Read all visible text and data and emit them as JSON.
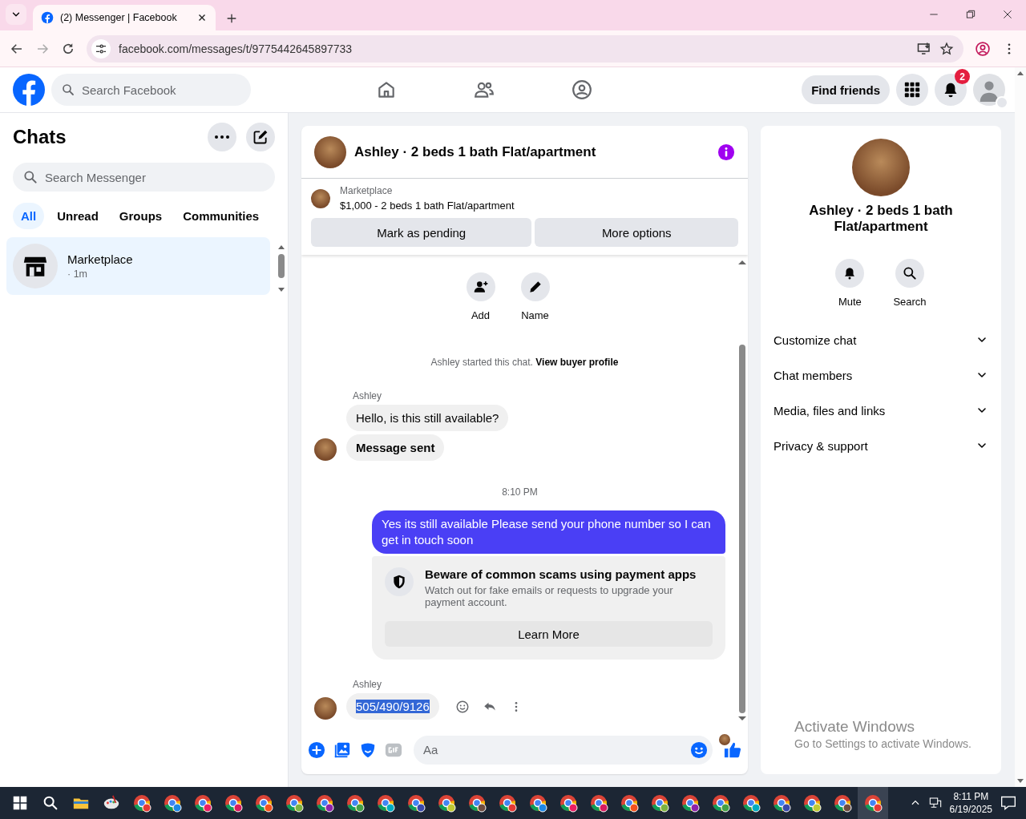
{
  "browser": {
    "tab_title": "(2) Messenger | Facebook",
    "url": "facebook.com/messages/t/9775442645897733"
  },
  "header": {
    "search_placeholder": "Search Facebook",
    "find_friends": "Find friends",
    "notification_count": "2"
  },
  "chats": {
    "title": "Chats",
    "search_placeholder": "Search Messenger",
    "filters": [
      {
        "label": "All",
        "selected": true
      },
      {
        "label": "Unread",
        "selected": false
      },
      {
        "label": "Groups",
        "selected": false
      },
      {
        "label": "Communities",
        "selected": false
      }
    ],
    "conversations": [
      {
        "name": "Marketplace",
        "meta": "· 1m",
        "selected": true
      }
    ]
  },
  "conversation": {
    "title": "Ashley · 2 beds 1 bath Flat/apartment",
    "listing": {
      "source": "Marketplace",
      "title": "$1,000 - 2 beds 1 bath Flat/apartment"
    },
    "actions": [
      "Mark as pending",
      "More options"
    ],
    "quick_actions": [
      {
        "label": "Add",
        "kind": "add"
      },
      {
        "label": "Name",
        "kind": "name"
      }
    ],
    "notice": {
      "text": "Ashley started this chat.",
      "link": "View buyer profile"
    },
    "messages": [
      {
        "kind": "sender",
        "text": "Ashley"
      },
      {
        "kind": "incoming",
        "text": "Hello, is this still available?",
        "avatar": false,
        "highlighted": false
      },
      {
        "kind": "incoming",
        "text": "Message sent",
        "avatar": true,
        "highlighted": false
      },
      {
        "kind": "time",
        "text": "8:10 PM"
      },
      {
        "kind": "outgoing",
        "text": "Yes its still available Please send your phone number so I can get in touch soon"
      },
      {
        "kind": "warning",
        "title": "Beware of common scams using payment apps",
        "text": "Watch out for fake emails or requests to upgrade your payment account.",
        "button": "Learn More"
      },
      {
        "kind": "sender",
        "text": "Ashley"
      },
      {
        "kind": "incoming",
        "text": "505/490/9126",
        "avatar": true,
        "highlighted": true
      }
    ],
    "composer_placeholder": "Aa"
  },
  "details": {
    "name": "Ashley · 2 beds 1 bath Flat/apartment",
    "actions": [
      {
        "label": "Mute",
        "kind": "mute"
      },
      {
        "label": "Search",
        "kind": "search"
      }
    ],
    "sections": [
      {
        "label": "Customize chat",
        "expanded": false
      },
      {
        "label": "Chat members",
        "expanded": false
      },
      {
        "label": "Media, files and links",
        "expanded": false
      },
      {
        "label": "Privacy & support",
        "expanded": false
      }
    ]
  },
  "activation": {
    "title": "Activate Windows",
    "subtitle": "Go to Settings to activate Windows."
  },
  "taskbar": {
    "time": "8:11 PM",
    "date": "6/19/2025"
  }
}
